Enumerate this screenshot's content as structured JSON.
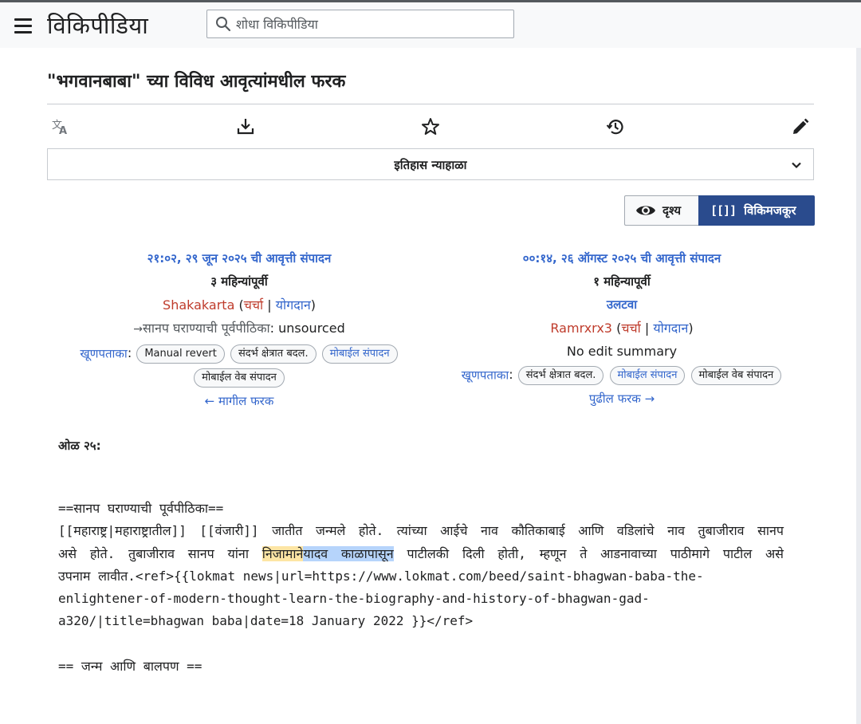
{
  "header": {
    "logo": "विकिपीडिया",
    "search_placeholder": "शोधा विकिपीडिया"
  },
  "page": {
    "title": "\"भगवानबाबा\" च्या विविध आवृत्यांमधील फरक"
  },
  "history": {
    "label": "इतिहास न्याहाळा"
  },
  "view_toggle": {
    "visual_label": "दृश्य",
    "wikitext_brackets": "[[]]",
    "wikitext_label": "विकिमजकूर"
  },
  "old_revision": {
    "title": "२१:०२, २९ जून २०२५ ची आवृत्ती संपादन",
    "ago": "३ महिन्यांपूर्वी",
    "user": "Shakakarta",
    "talk": "चर्चा",
    "contribs": "योगदान",
    "summary_arrow": "→",
    "summary_section": "सानप घराण्याची पूर्वपीठिका",
    "summary_text": ": unsourced",
    "tags_label": "खूणपताका",
    "tags": [
      "Manual revert",
      "संदर्भ क्षेत्रात बदल.",
      "मोबाईल संपादन",
      "मोबाईल वेब संपादन"
    ],
    "nav": "← मागील फरक"
  },
  "new_revision": {
    "title": "००:१४, २६ ऑगस्ट २०२५ ची आवृत्ती संपादन",
    "ago": "१ महिन्यापूर्वी",
    "undo": "उलटवा",
    "user": "Ramrxrx3",
    "talk": "चर्चा",
    "contribs": "योगदान",
    "summary": "No edit summary",
    "tags_label": "खूणपताका",
    "tags": [
      "संदर्भ क्षेत्रात बदल.",
      "मोबाईल संपादन",
      "मोबाईल वेब संपादन"
    ],
    "nav": "पुढील फरक →"
  },
  "diff": {
    "line_label": "ओळ २५:",
    "heading": "==सानप घराण्याची पूर्वपीठिका==",
    "p1": "[[महाराष्ट्र|महाराष्ट्रातील]] [[वंजारी]] जातीत जन्मले होते. त्यांच्या आईचे नाव कौतिकाबाई आणि वडिलांचे नाव तुबाजीराव सानप",
    "p2_before": "असे होते. तुबाजीराव सानप यांना ",
    "p2_hl_yellow": "निजामाने",
    "p2_hl_blue": "यादव काळापासून",
    "p2_after": " पाटीलकी दिली होती, म्हणून ते आडनावाच्या पाठीमागे पाटील असे",
    "p3": "उपनाम लावीत.<ref>{{lokmat news|url=https://www.lokmat.com/beed/saint-bhagwan-baba-the-",
    "p4": "enlightener-of-modern-thought-learn-the-biography-and-history-of-bhagwan-gad-",
    "p5": "a320/|title=bhagwan baba|date=18 January 2022 }}</ref>",
    "heading2": "== जन्म आणि बालपण =="
  },
  "colors": {
    "link": "#3366cc",
    "redlink": "#bf3c2c",
    "active_toggle": "#2a4b8d",
    "highlight_removed": "#fde5a4",
    "highlight_added": "#b6d4fb"
  }
}
